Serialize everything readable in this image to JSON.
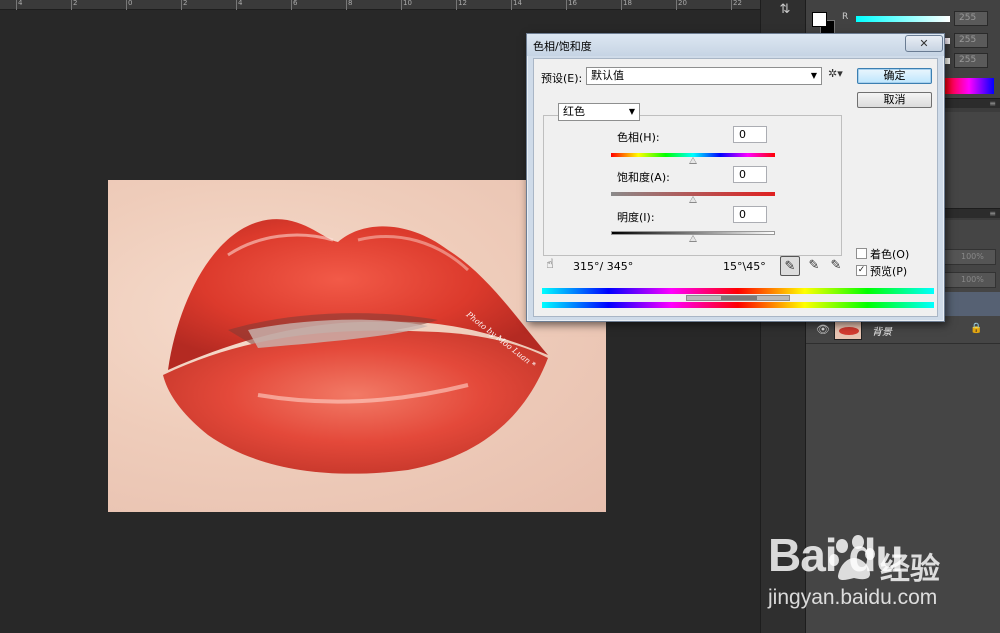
{
  "ruler": {
    "marks": [
      "4",
      "2",
      "0",
      "2",
      "4",
      "6",
      "8",
      "10",
      "12",
      "14",
      "16",
      "18",
      "20",
      "22"
    ]
  },
  "photo": {
    "watermark": "Photo by Moo Luan *"
  },
  "color_panel": {
    "channel_r": "R",
    "values": [
      "255",
      "255",
      "255"
    ]
  },
  "dialog": {
    "title": "色相/饱和度",
    "close": "✕",
    "preset_label": "预设(E):",
    "preset_value": "默认值",
    "ok": "确定",
    "cancel": "取消",
    "channel": "红色",
    "hue_label": "色相(H):",
    "hue_value": "0",
    "saturation_label": "饱和度(A):",
    "saturation_value": "0",
    "lightness_label": "明度(I):",
    "lightness_value": "0",
    "range_left": "315°/ 345°",
    "range_right": "15°\\45°",
    "colorize_label": "着色(O)",
    "preview_label": "预览(P)",
    "colorize_checked": false,
    "preview_checked": true
  },
  "layers": {
    "opacity": "100%",
    "fill": "100%",
    "background_name": "背景"
  },
  "watermark": {
    "logo": "Bai du",
    "brand": "经验",
    "url": "jingyan.baidu.com"
  }
}
